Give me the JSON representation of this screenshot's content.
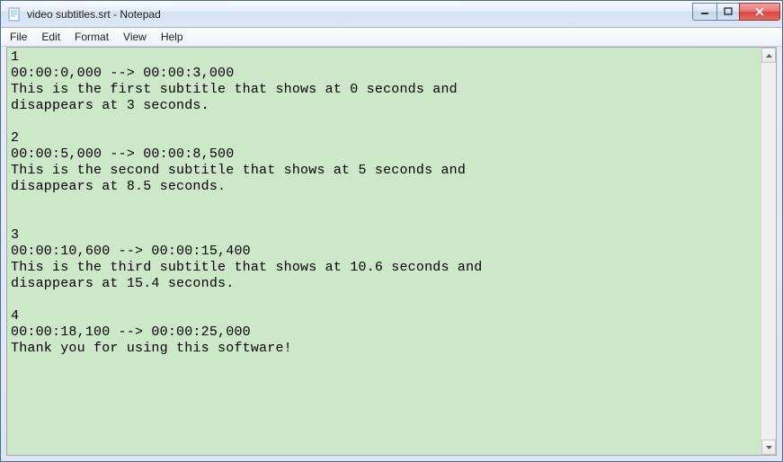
{
  "window": {
    "title": "video subtitles.srt - Notepad"
  },
  "menu": {
    "file": "File",
    "edit": "Edit",
    "format": "Format",
    "view": "View",
    "help": "Help"
  },
  "content": {
    "text": "1\n00:00:0,000 --> 00:00:3,000\nThis is the first subtitle that shows at 0 seconds and\ndisappears at 3 seconds.\n\n2\n00:00:5,000 --> 00:00:8,500\nThis is the second subtitle that shows at 5 seconds and\ndisappears at 8.5 seconds.\n\n\n3\n00:00:10,600 --> 00:00:15,400\nThis is the third subtitle that shows at 10.6 seconds and\ndisappears at 15.4 seconds.\n\n4\n00:00:18,100 --> 00:00:25,000\nThank you for using this software!"
  }
}
